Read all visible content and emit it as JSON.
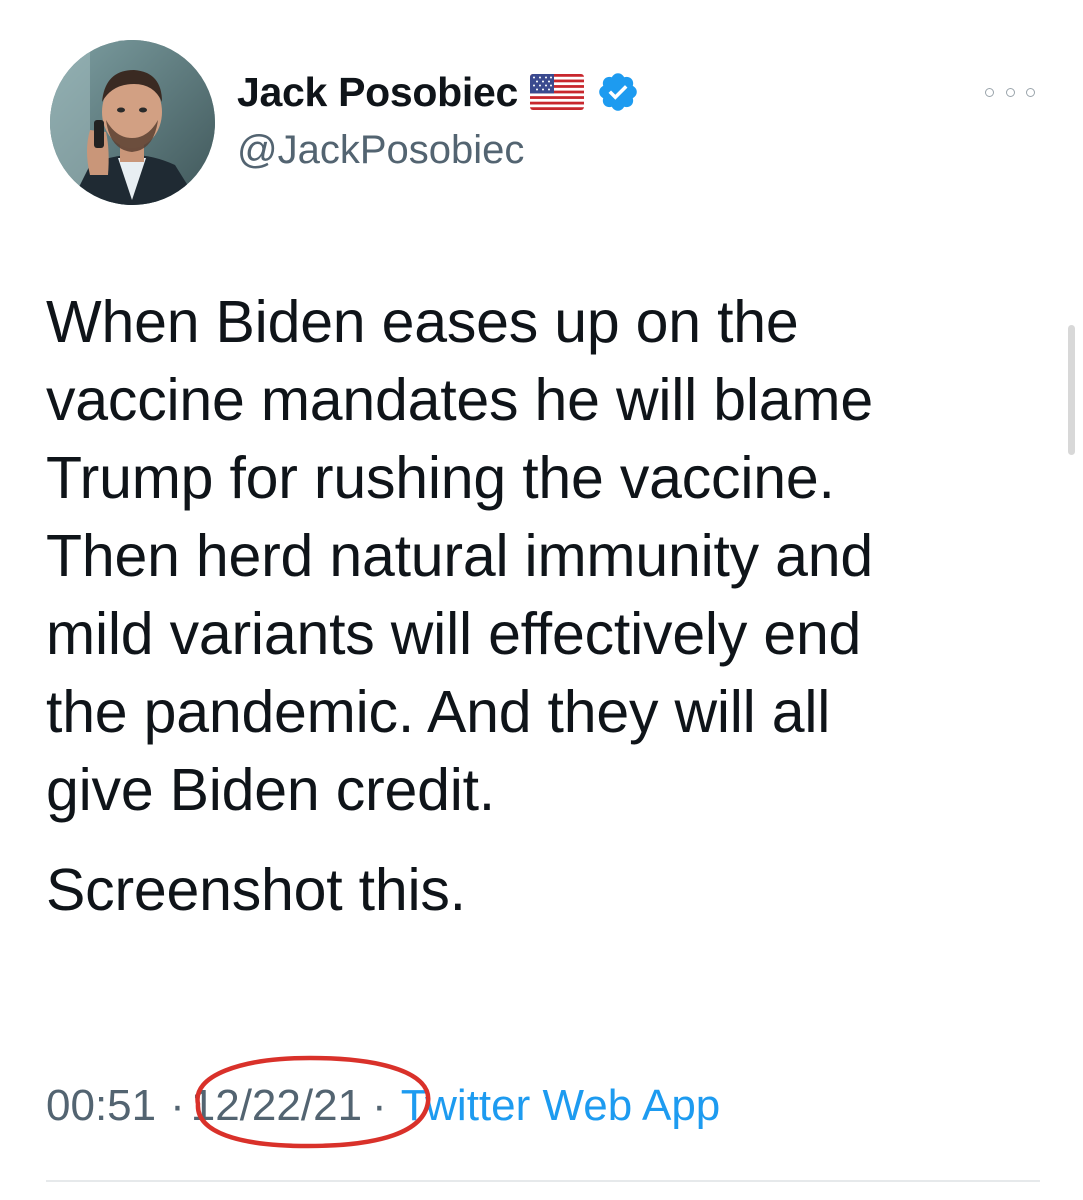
{
  "author": {
    "display_name": "Jack Posobiec",
    "handle": "@JackPosobiec"
  },
  "tweet": {
    "paragraphs": [
      [
        "When Biden eases up on the",
        "vaccine mandates he will blame",
        "Trump for rushing the vaccine.",
        "Then herd natural immunity and",
        "mild variants will effectively end",
        "the pandemic. And they will all",
        "give Biden credit."
      ],
      [
        "Screenshot this."
      ]
    ]
  },
  "meta": {
    "time": "00:51",
    "separator": "·",
    "date": "12/22/21",
    "source": "Twitter Web App"
  },
  "icons": {
    "flag": "us-flag-icon",
    "verified": "verified-badge-icon",
    "more": "more-options-icon"
  },
  "colors": {
    "verified": "#1d9bf0",
    "link": "#1d9bf0",
    "muted_text": "#536471",
    "annotation_circle": "#d9312a"
  }
}
